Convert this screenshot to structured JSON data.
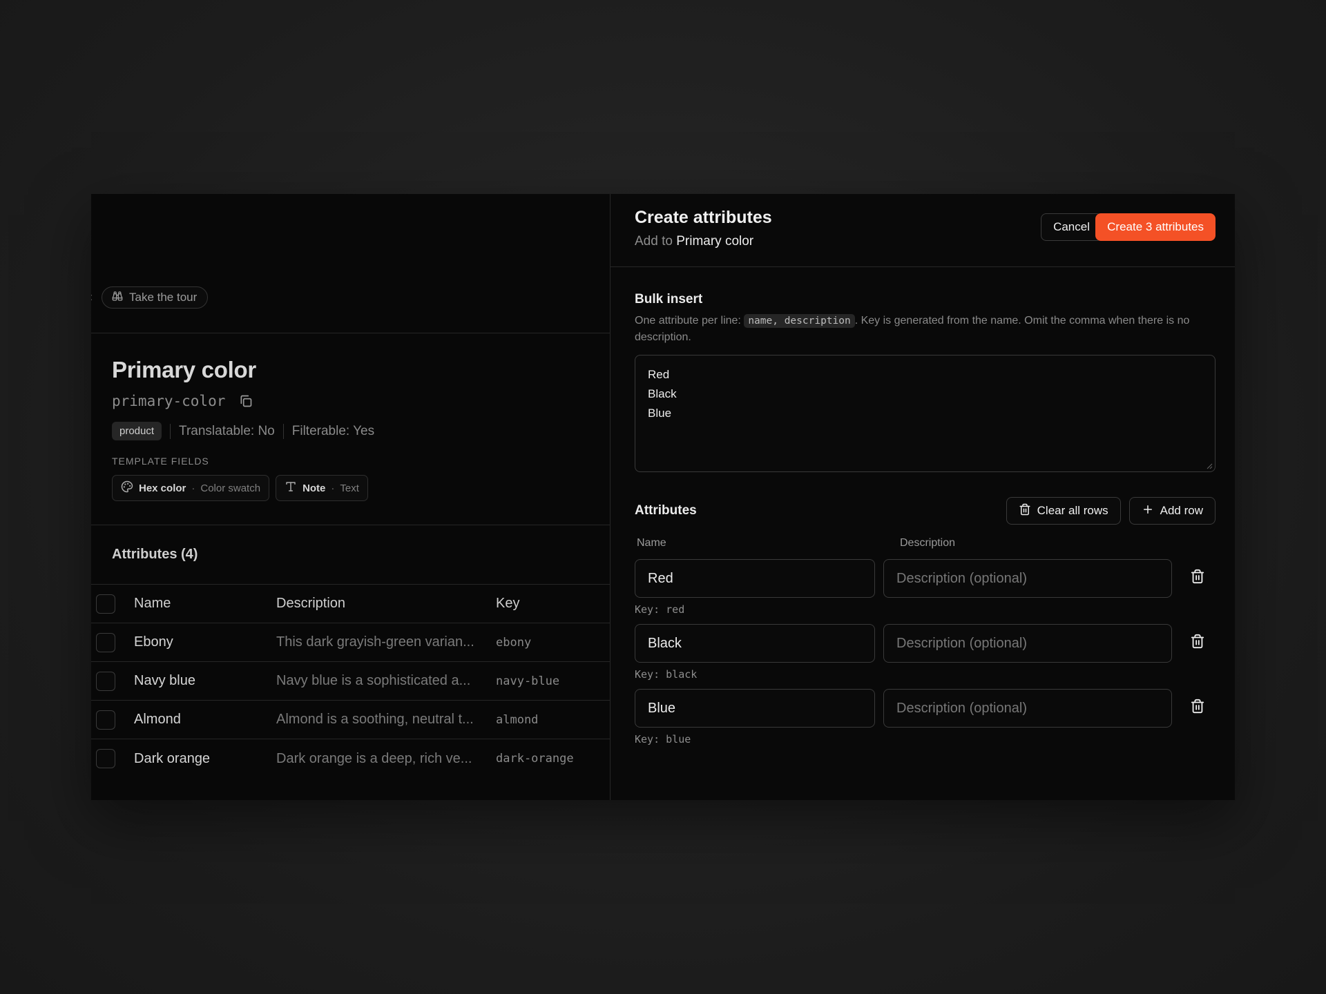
{
  "left": {
    "tour_label": "Take the tour",
    "title": "Primary color",
    "slug": "primary-color",
    "badge": "product",
    "translatable": "Translatable: No",
    "filterable": "Filterable: Yes",
    "template_fields_label": "TEMPLATE FIELDS",
    "template_fields": [
      {
        "name": "Hex color",
        "type": "Color swatch",
        "icon": "palette-icon"
      },
      {
        "name": "Note",
        "type": "Text",
        "icon": "text-type-icon"
      }
    ],
    "attributes_heading": "Attributes (4)",
    "table": {
      "headers": {
        "name": "Name",
        "description": "Description",
        "key": "Key"
      },
      "rows": [
        {
          "name": "Ebony",
          "description": "This dark grayish-green varian...",
          "key": "ebony"
        },
        {
          "name": "Navy blue",
          "description": "Navy blue is a sophisticated a...",
          "key": "navy-blue"
        },
        {
          "name": "Almond",
          "description": "Almond is a soothing, neutral t...",
          "key": "almond"
        },
        {
          "name": "Dark orange",
          "description": "Dark orange is a deep, rich ve...",
          "key": "dark-orange"
        }
      ]
    }
  },
  "dialog": {
    "title": "Create attributes",
    "subtitle_prefix": "Add to",
    "subtitle_target": "Primary color",
    "cancel_label": "Cancel",
    "create_label": "Create 3 attributes",
    "accent_color": "#f45126",
    "bulk": {
      "title": "Bulk insert",
      "help_prefix": "One attribute per line: ",
      "help_code": "name, description",
      "help_suffix": ". Key is generated from the name. Omit the comma when there is no description.",
      "lines": [
        "Red",
        "Black",
        "Blue"
      ]
    },
    "attributes": {
      "title": "Attributes",
      "clear_label": "Clear all rows",
      "add_label": "Add row",
      "col_name": "Name",
      "col_description": "Description",
      "desc_placeholder": "Description (optional)",
      "key_prefix": "Key:",
      "rows": [
        {
          "name": "Red",
          "key": "red"
        },
        {
          "name": "Black",
          "key": "black"
        },
        {
          "name": "Blue",
          "key": "blue"
        }
      ]
    }
  }
}
